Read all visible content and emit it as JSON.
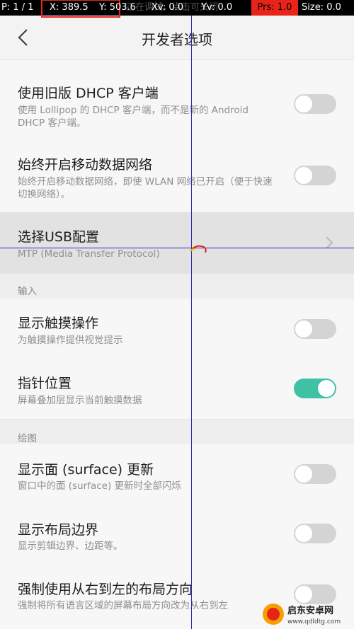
{
  "overlay": {
    "pointer": "P: 1 / 1",
    "x": "X: 389.5",
    "y": "Y: 503.6",
    "xv": "Xv: 0.0",
    "yv": "Yv: 0.0",
    "prs": "Prs: 1.0",
    "size": "Size: 0.0",
    "toast": "正在调试。点击可关闭"
  },
  "header": {
    "title": "开发者选项",
    "back_icon": "chevron-left-icon"
  },
  "items": [
    {
      "title": "使用旧版 DHCP 客户端",
      "subtitle": "使用 Lollipop 的 DHCP 客户端，而不是新的 Android DHCP 客户端。",
      "toggle": "off"
    },
    {
      "title": "始终开启移动数据网络",
      "subtitle": "始终开启移动数据网络，即使 WLAN 网络已开启（便于快速切换网络）。",
      "toggle": "off"
    },
    {
      "title": "选择USB配置",
      "subtitle": "MTP (Media Transfer Protocol)",
      "control": "chevron-right-icon"
    },
    {
      "title": "显示触摸操作",
      "subtitle": "为触摸操作提供视觉提示",
      "toggle": "off"
    },
    {
      "title": "指针位置",
      "subtitle": "屏幕叠加层显示当前触摸数据",
      "toggle": "on"
    },
    {
      "title": "显示面 (surface) 更新",
      "subtitle": "窗口中的面 (surface) 更新时全部闪烁",
      "toggle": "off"
    },
    {
      "title": "显示布局边界",
      "subtitle": "显示剪辑边界、边距等。",
      "toggle": "off"
    },
    {
      "title": "强制使用从右到左的布局方向",
      "subtitle": "强制将所有语言区域的屏幕布局方向改为从右到左",
      "toggle": "off"
    }
  ],
  "sections": {
    "input": "输入",
    "drawing": "绘图"
  },
  "watermark": {
    "name": "启东安卓网",
    "url": "www.qdldtg.com"
  },
  "colors": {
    "toggle_on": "#3fc1a4",
    "toggle_off": "#d4d4d4",
    "crosshair": "#2b2bb3",
    "overlay_highlight": "#e8241a"
  }
}
